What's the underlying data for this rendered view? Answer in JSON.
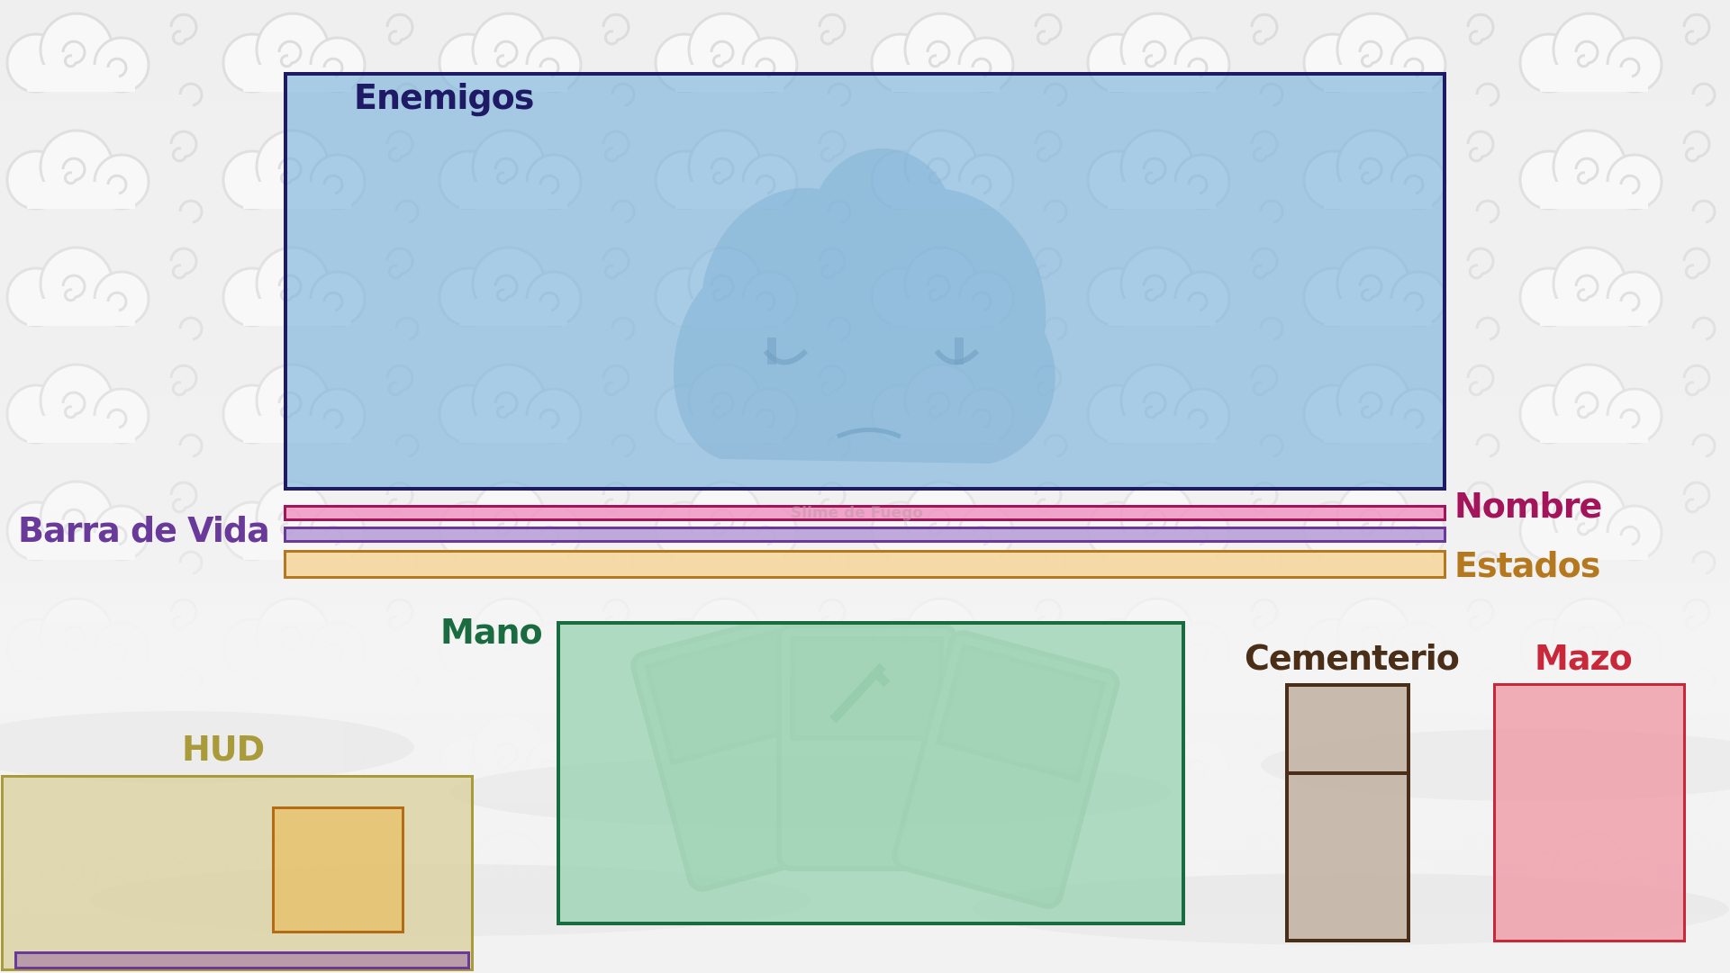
{
  "zones": {
    "enemigos": "Enemigos",
    "nombre": "Nombre",
    "barra_de_vida": "Barra de Vida",
    "estados": "Estados",
    "mano": "Mano",
    "cementerio": "Cementerio",
    "mazo": "Mazo",
    "hud": "HUD"
  },
  "enemy": {
    "name": "Slime de Fuego"
  },
  "colors": {
    "enemigos": "#1f1a66",
    "nombre": "#a3145a",
    "barra_de_vida": "#6a3a9a",
    "estados": "#b5781e",
    "mano": "#1a6b3f",
    "cementerio": "#4a2e18",
    "mazo": "#c8283a",
    "hud": "#a99a3a"
  },
  "icons": [
    "cloud-background",
    "slime-enemy-icon",
    "card-icon",
    "sword-icon"
  ]
}
